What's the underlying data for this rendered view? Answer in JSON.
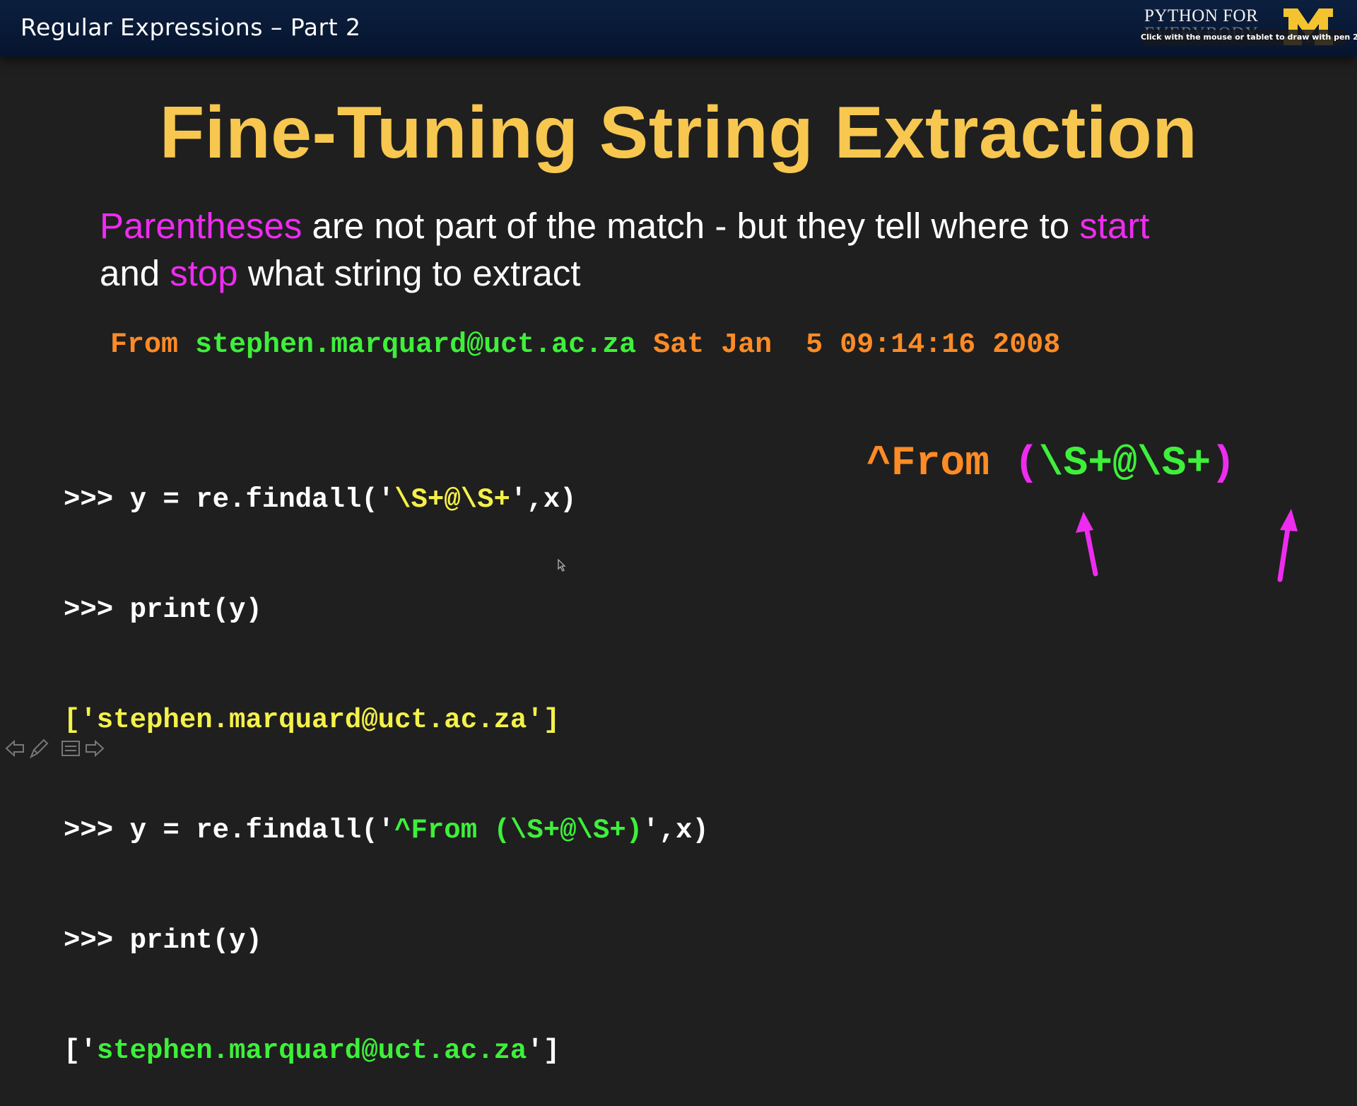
{
  "header": {
    "title": "Regular Expressions – Part 2",
    "brand_line1": "PYTHON FOR",
    "brand_line2": "EVERYBODY",
    "logo_letter": "M",
    "tooltip": "Click with the mouse or tablet to draw with pen 2"
  },
  "slide": {
    "title": "Fine-Tuning String Extraction",
    "description": {
      "w1": "Parentheses",
      "t1": " are not part of the match - but they tell where to ",
      "w2": "start",
      "t2": "and ",
      "w3": "stop",
      "t3": " what string to extract"
    },
    "email_line": {
      "from": "From ",
      "email": "stephen.marquard@uct.ac.za",
      "date": " Sat Jan  5 09:14:16 2008"
    },
    "code": {
      "l1_prompt": ">>> y = re.findall('",
      "l1_pattern": "\\S+@\\S+",
      "l1_end": "',x)",
      "l2": ">>> print(y)",
      "l3": "['stephen.marquard@uct.ac.za']",
      "l4_prompt": ">>> y = re.findall('",
      "l4_pattern1": "^From ",
      "l4_paren_open": "(",
      "l4_pattern2": "\\S+@\\S+",
      "l4_paren_close": ")",
      "l4_end": "',x)",
      "l5": ">>> print(y)",
      "l6_open": "['",
      "l6_value": "stephen.marquard@uct.ac.za",
      "l6_close": "']"
    },
    "regex_display": {
      "prefix": "^From ",
      "paren_open": "(",
      "inner": "\\S+@\\S+",
      "paren_close": ")"
    }
  },
  "colors": {
    "background": "#1f1f1f",
    "header": "#0c1f3f",
    "title": "#f7c74f",
    "highlight_magenta": "#ee2cf0",
    "orange": "#ff8b25",
    "green": "#3ef03a",
    "yellow": "#f4f14a"
  },
  "icons": {
    "nav_back": "arrow-left-icon",
    "pen": "pen-icon",
    "menu": "slide-menu-icon",
    "nav_forward": "arrow-right-icon"
  }
}
